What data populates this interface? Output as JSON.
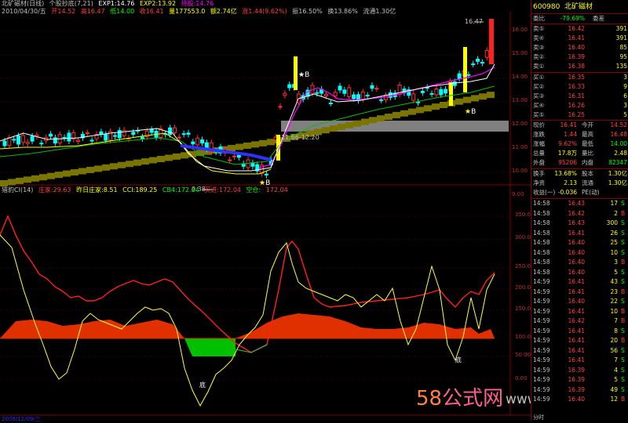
{
  "top_info": {
    "title": "北矿磁材(日线)",
    "formula": "个股抄底(7,21)",
    "exp1": "EXP1:14.76",
    "exp2": "EXP2:13.92",
    "line3": "持股:14.76",
    "date": "2010/04/30/五",
    "open": "开14.52",
    "high": "高16.47",
    "low": "低14.00",
    "close": "收16.41",
    "volume": "量177553.0",
    "amount": "额2.74亿",
    "change": "涨1.44(9.62%)",
    "amplitude": "振16.50%",
    "turnover": "换13.86%",
    "float": "流通1.30亿"
  },
  "price_axis": [
    "16.00",
    "15.00",
    "14.00",
    "13.00",
    "12.00",
    "11.00",
    "10.00",
    "9.00"
  ],
  "price_annotations": {
    "high": "16.47",
    "box": "11.66-12.20",
    "low": "9.38",
    "buy1": "B",
    "buy2": "B",
    "buy3": "B"
  },
  "indicator_info": {
    "name": "猎豹CI(14)",
    "zhuangjia": "庄家:29.63",
    "zuori": "昨日庄家:8.51",
    "cci": "CCI:189.25",
    "cb4": "CB4:172.04",
    "kaijin": "买进:172.04",
    "kongcang": "空仓:",
    "kongcang_val": "172.04"
  },
  "ind_axis": [
    "350.00",
    "300.00",
    "250.00",
    "200.00",
    "150.00",
    "100.00",
    "50.00",
    "0.00",
    "-50.00",
    "-100.00"
  ],
  "ind_labels": {
    "di1": "底",
    "di2": "底"
  },
  "watermark": {
    "num": "58",
    "text": "公式网",
    "url": "www.58gu.com"
  },
  "bottom": {
    "date_left": "2009/12/09/三"
  },
  "panel": {
    "code": "600980",
    "name": "北矿磁材",
    "weibi_label": "委比",
    "weibi_val": "-79.69%",
    "weicha_label": "委差",
    "sells": [
      {
        "label": "卖⑤",
        "price": "16.42",
        "vol": "391"
      },
      {
        "label": "卖④",
        "price": "16.41",
        "vol": "391"
      },
      {
        "label": "卖③",
        "price": "16.40",
        "vol": "85"
      },
      {
        "label": "卖②",
        "price": "16.39",
        "vol": "95"
      },
      {
        "label": "卖①",
        "price": "16.38",
        "vol": "135"
      }
    ],
    "buys": [
      {
        "label": "买①",
        "price": "16.35",
        "vol": "3"
      },
      {
        "label": "买②",
        "price": "16.33",
        "vol": "9"
      },
      {
        "label": "买③",
        "price": "16.31",
        "vol": "6"
      },
      {
        "label": "买④",
        "price": "16.26",
        "vol": "3"
      },
      {
        "label": "买⑤",
        "price": "16.25",
        "vol": "5"
      }
    ],
    "quote": [
      {
        "l1": "现价",
        "v1": "16.41",
        "l2": "今开",
        "v2": "14.52"
      },
      {
        "l1": "涨跌",
        "v1": "1.44",
        "l2": "最高",
        "v2": "16.48"
      },
      {
        "l1": "涨幅",
        "v1": "9.62%",
        "l2": "最低",
        "v2": "14.00"
      },
      {
        "l1": "总量",
        "v1": "17.8万",
        "l2": "量比",
        "v2": "2.48"
      },
      {
        "l1": "外盘",
        "v1": "95206",
        "l2": "内盘",
        "v2": "82347"
      }
    ],
    "extra": [
      {
        "l1": "换手",
        "v1": "13.68%",
        "l2": "股本",
        "v2": "1.30亿"
      },
      {
        "l1": "净资",
        "v1": "2.13",
        "l2": "流通",
        "v2": "1.30亿"
      },
      {
        "l1": "收益(一)",
        "v1": "-0.036",
        "l2": "PE(动)",
        "v2": ""
      }
    ],
    "ticks": [
      {
        "t": "14:58",
        "p": "16.43",
        "v": "17",
        "s": "S"
      },
      {
        "t": "14:58",
        "p": "16.42",
        "v": "2",
        "s": "B"
      },
      {
        "t": "14:58",
        "p": "16.43",
        "v": "300",
        "s": "S"
      },
      {
        "t": "14:58",
        "p": "16.41",
        "v": "26",
        "s": "S"
      },
      {
        "t": "14:58",
        "p": "16.40",
        "v": "25",
        "s": "S"
      },
      {
        "t": "14:58",
        "p": "16.40",
        "v": "10",
        "s": "S"
      },
      {
        "t": "14:58",
        "p": "16.40",
        "v": "3",
        "s": "B"
      },
      {
        "t": "14:58",
        "p": "16.40",
        "v": "5",
        "s": "S"
      },
      {
        "t": "14:59",
        "p": "16.41",
        "v": "43",
        "s": "S"
      },
      {
        "t": "14:59",
        "p": "16.41",
        "v": "23",
        "s": "B"
      },
      {
        "t": "14:59",
        "p": "16.40",
        "v": "22",
        "s": "S"
      },
      {
        "t": "14:59",
        "p": "16.41",
        "v": "10",
        "s": "B"
      },
      {
        "t": "14:59",
        "p": "16.42",
        "v": "7",
        "s": "B"
      },
      {
        "t": "14:59",
        "p": "16.41",
        "v": "8",
        "s": "S"
      },
      {
        "t": "14:59",
        "p": "16.41",
        "v": "20",
        "s": "B"
      },
      {
        "t": "14:59",
        "p": "16.41",
        "v": "56",
        "s": "S"
      },
      {
        "t": "14:59",
        "p": "16.41",
        "v": "7",
        "s": "S"
      },
      {
        "t": "14:59",
        "p": "16.39",
        "v": "4",
        "s": "S"
      },
      {
        "t": "14:59",
        "p": "16.39",
        "v": "5",
        "s": "S"
      },
      {
        "t": "14:59",
        "p": "16.39",
        "v": "49",
        "s": "S"
      },
      {
        "t": "14:59",
        "p": "16.40",
        "v": "12",
        "s": "B"
      }
    ],
    "footer": "分时"
  },
  "colors": {
    "up": "#ff3030",
    "down": "#00ffff",
    "ma1": "#ffffff",
    "ma2": "#ffff00",
    "ma3": "#ff00ff",
    "ma4": "#00ff00",
    "panel_label": "#c0c0c0",
    "price": "#ff4040",
    "blue": "#3030ff",
    "olive": "#8b8000"
  }
}
